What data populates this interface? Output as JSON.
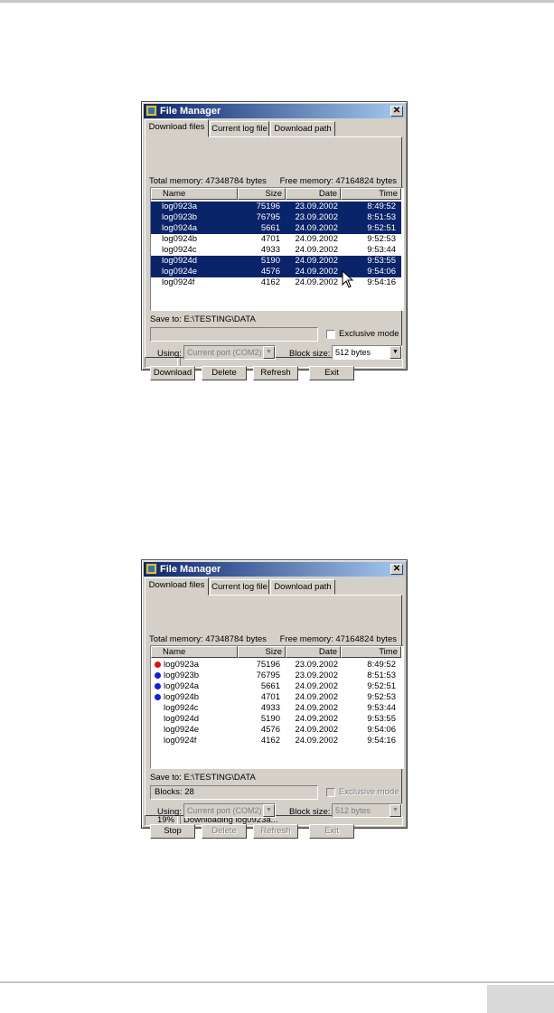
{
  "windows": [
    {
      "title": "File Manager",
      "tabs": [
        "Download files",
        "Current log file",
        "Download path"
      ],
      "total_memory": "Total memory: 47348784 bytes",
      "free_memory": "Free memory: 47164824 bytes",
      "columns": [
        "Name",
        "Size",
        "Date",
        "Time"
      ],
      "rows": [
        {
          "name": "log0923a",
          "size": "75196",
          "date": "23.09.2002",
          "time": "8:49:52",
          "selected": true
        },
        {
          "name": "log0923b",
          "size": "76795",
          "date": "23.09.2002",
          "time": "8:51:53",
          "selected": true
        },
        {
          "name": "log0924a",
          "size": "5661",
          "date": "24.09.2002",
          "time": "9:52:51",
          "selected": true
        },
        {
          "name": "log0924b",
          "size": "4701",
          "date": "24.09.2002",
          "time": "9:52:53",
          "selected": false
        },
        {
          "name": "log0924c",
          "size": "4933",
          "date": "24.09.2002",
          "time": "9:53:44",
          "selected": false
        },
        {
          "name": "log0924d",
          "size": "5190",
          "date": "24.09.2002",
          "time": "9:53:55",
          "selected": true
        },
        {
          "name": "log0924e",
          "size": "4576",
          "date": "24.09.2002",
          "time": "9:54:06",
          "selected": true
        },
        {
          "name": "log0924f",
          "size": "4162",
          "date": "24.09.2002",
          "time": "9:54:16",
          "selected": false
        }
      ],
      "save_to": "Save to: E:\\TESTING\\DATA",
      "status_field": "",
      "exclusive_mode": "Exclusive mode",
      "using_label": "Using:",
      "using_value": "Current port (COM2)",
      "block_size_label": "Block size:",
      "block_size_value": "512 bytes",
      "buttons": [
        "Download",
        "Delete",
        "Refresh",
        "Exit"
      ],
      "status_left": "",
      "status_right": ""
    },
    {
      "title": "File Manager",
      "tabs": [
        "Download files",
        "Current log file",
        "Download path"
      ],
      "total_memory": "Total memory: 47348784 bytes",
      "free_memory": "Free memory: 47164824 bytes",
      "columns": [
        "Name",
        "Size",
        "Date",
        "Time"
      ],
      "rows": [
        {
          "name": "log0923a",
          "size": "75196",
          "date": "23.09.2002",
          "time": "8:49:52",
          "marker": "#e01010"
        },
        {
          "name": "log0923b",
          "size": "76795",
          "date": "23.09.2002",
          "time": "8:51:53",
          "marker": "#1020e0"
        },
        {
          "name": "log0924a",
          "size": "5661",
          "date": "24.09.2002",
          "time": "9:52:51",
          "marker": "#1020e0"
        },
        {
          "name": "log0924b",
          "size": "4701",
          "date": "24.09.2002",
          "time": "9:52:53",
          "marker": "#1020e0"
        },
        {
          "name": "log0924c",
          "size": "4933",
          "date": "24.09.2002",
          "time": "9:53:44",
          "marker": null
        },
        {
          "name": "log0924d",
          "size": "5190",
          "date": "24.09.2002",
          "time": "9:53:55",
          "marker": null
        },
        {
          "name": "log0924e",
          "size": "4576",
          "date": "24.09.2002",
          "time": "9:54:06",
          "marker": null
        },
        {
          "name": "log0924f",
          "size": "4162",
          "date": "24.09.2002",
          "time": "9:54:16",
          "marker": null
        }
      ],
      "save_to": "Save to: E:\\TESTING\\DATA",
      "status_field": "Blocks: 28",
      "exclusive_mode": "Exclusive mode",
      "using_label": "Using:",
      "using_value": "Current port (COM2)",
      "block_size_label": "Block size:",
      "block_size_value": "512 bytes",
      "buttons": [
        "Stop",
        "Delete",
        "Refresh",
        "Exit"
      ],
      "status_left": "19%",
      "status_right": "Downloading log0923a..."
    }
  ],
  "colors": {
    "selection": "#0a246a",
    "marker_in_progress": "#e01010",
    "marker_queued": "#1020e0"
  }
}
